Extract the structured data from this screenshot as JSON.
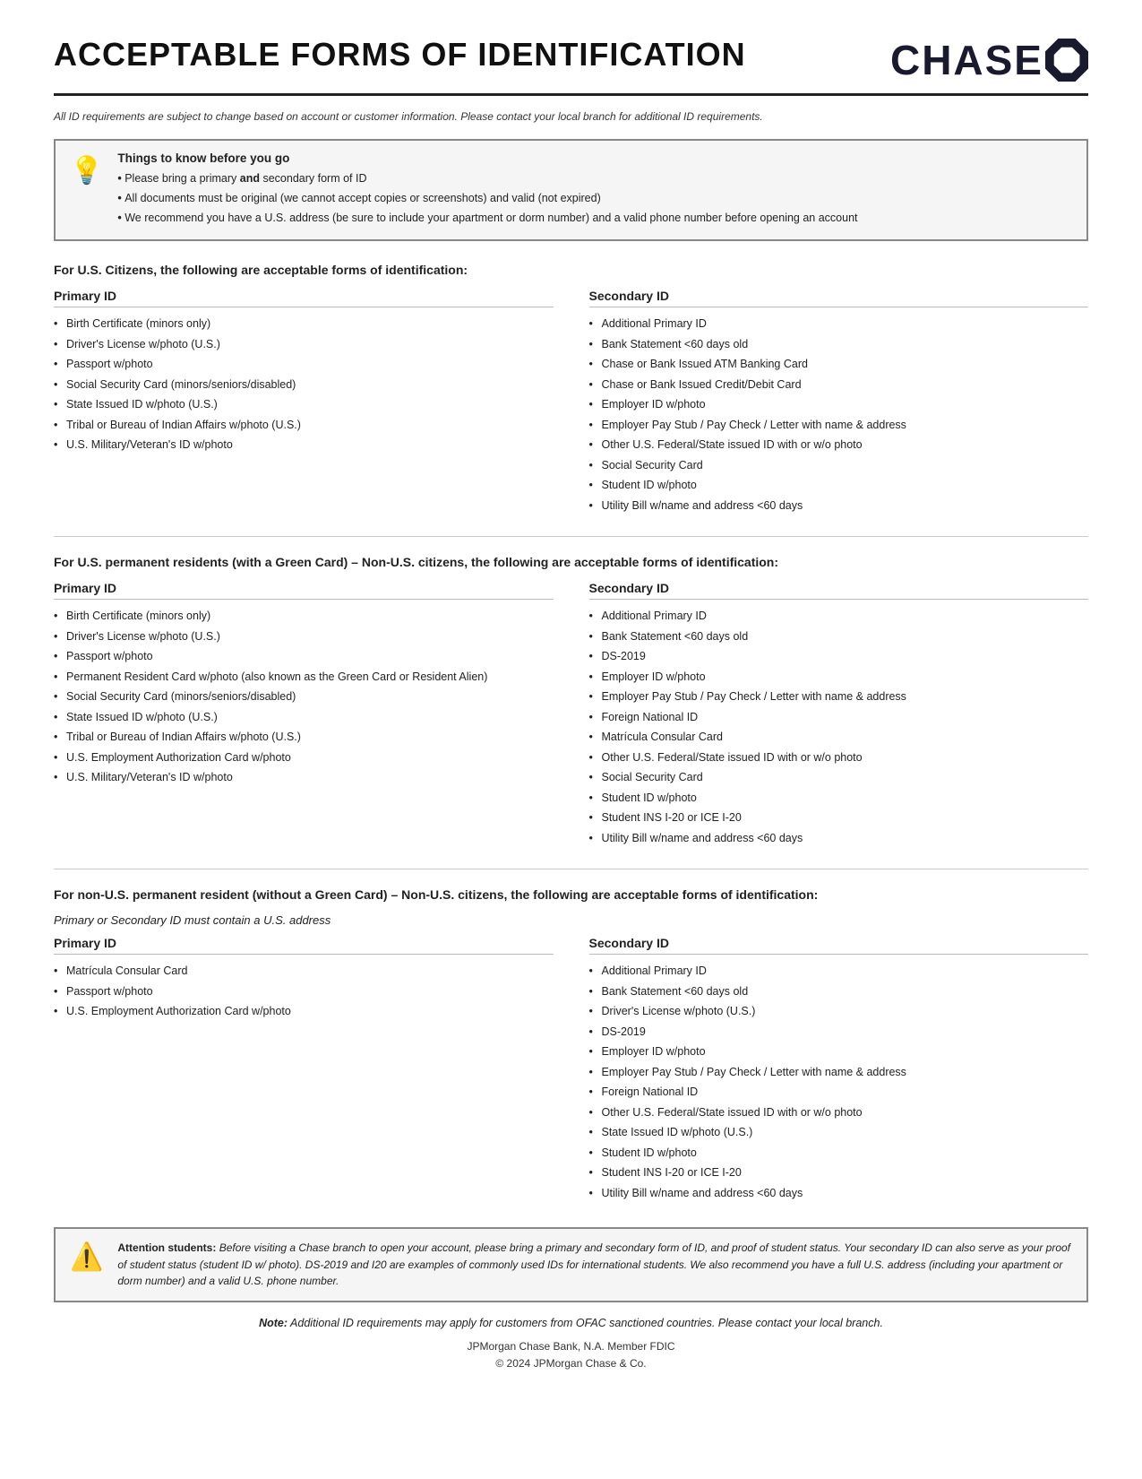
{
  "page": {
    "title": "ACCEPTABLE FORMS OF IDENTIFICATION",
    "chase_brand": "CHASE",
    "disclaimer": "All ID requirements are subject to change based on account or customer information. Please contact your local branch for additional ID requirements.",
    "info_box": {
      "title": "Things to know before you go",
      "items": [
        "Please bring a primary and secondary form of ID",
        "All documents must be original (we cannot accept copies or screenshots) and valid (not expired)",
        "We recommend you have a U.S. address (be sure to include your apartment or dorm number) and a valid phone number before opening an account"
      ]
    },
    "us_citizens": {
      "heading": "For U.S. Citizens, the following are acceptable forms of identification:",
      "primary_label": "Primary ID",
      "secondary_label": "Secondary ID",
      "primary_items": [
        "Birth Certificate (minors only)",
        "Driver's License w/photo (U.S.)",
        "Passport w/photo",
        "Social Security Card (minors/seniors/disabled)",
        "State Issued ID w/photo (U.S.)",
        "Tribal or Bureau of Indian Affairs w/photo (U.S.)",
        "U.S. Military/Veteran's ID w/photo"
      ],
      "secondary_items": [
        "Additional Primary ID",
        "Bank Statement <60 days old",
        "Chase or Bank Issued ATM Banking Card",
        "Chase or Bank Issued Credit/Debit Card",
        "Employer ID w/photo",
        "Employer Pay Stub / Pay Check / Letter with name & address",
        "Other U.S. Federal/State issued ID with or w/o photo",
        "Social Security Card",
        "Student ID w/photo",
        "Utility Bill w/name and address <60 days"
      ]
    },
    "permanent_residents": {
      "heading": "For U.S. permanent residents (with a Green Card) – Non-U.S. citizens, the following are acceptable forms of identification:",
      "primary_label": "Primary ID",
      "secondary_label": "Secondary ID",
      "primary_items": [
        "Birth Certificate (minors only)",
        "Driver's License w/photo (U.S.)",
        "Passport w/photo",
        "Permanent Resident Card w/photo (also known as the Green Card or Resident Alien)",
        "Social Security Card (minors/seniors/disabled)",
        "State Issued ID w/photo (U.S.)",
        "Tribal or Bureau of Indian Affairs w/photo (U.S.)",
        "U.S. Employment Authorization Card w/photo",
        "U.S. Military/Veteran's ID w/photo"
      ],
      "secondary_items": [
        "Additional Primary ID",
        "Bank Statement <60 days old",
        "DS-2019",
        "Employer ID w/photo",
        "Employer Pay Stub / Pay Check / Letter with name & address",
        "Foreign National ID",
        "Matrícula Consular Card",
        "Other U.S. Federal/State issued ID with or w/o photo",
        "Social Security Card",
        "Student ID w/photo",
        "Student INS I-20 or ICE I-20",
        "Utility Bill w/name and address <60 days"
      ]
    },
    "non_permanent": {
      "heading": "For non-U.S. permanent resident (without a Green Card) – Non-U.S. citizens, the following are acceptable forms of identification:",
      "subtitle": "Primary or Secondary ID must contain a U.S. address",
      "primary_label": "Primary ID",
      "secondary_label": "Secondary ID",
      "primary_items": [
        "Matrícula Consular Card",
        "Passport w/photo",
        "U.S. Employment Authorization Card w/photo"
      ],
      "secondary_items": [
        "Additional Primary ID",
        "Bank Statement <60 days old",
        "Driver's License w/photo (U.S.)",
        "DS-2019",
        "Employer ID w/photo",
        "Employer Pay Stub / Pay Check / Letter with name & address",
        "Foreign National ID",
        "Other U.S. Federal/State issued ID with or w/o photo",
        "State Issued ID w/photo (U.S.)",
        "Student ID w/photo",
        "Student INS I-20 or ICE I-20",
        "Utility Bill w/name and address <60 days"
      ]
    },
    "attention_box": {
      "label": "Attention students:",
      "text": "Before visiting a Chase branch to open your account, please bring a primary and secondary form of ID, and proof of student status. Your secondary ID can also serve as your proof of student status (student ID w/ photo). DS-2019 and I20 are examples of commonly used IDs for international students. We also recommend you have a full U.S. address (including your apartment or dorm number) and a valid U.S. phone number."
    },
    "note": "Note: Additional ID requirements may apply for customers from OFAC sanctioned countries. Please contact your local branch.",
    "footer_line1": "JPMorgan Chase Bank, N.A. Member FDIC",
    "footer_line2": "© 2024 JPMorgan Chase & Co."
  }
}
